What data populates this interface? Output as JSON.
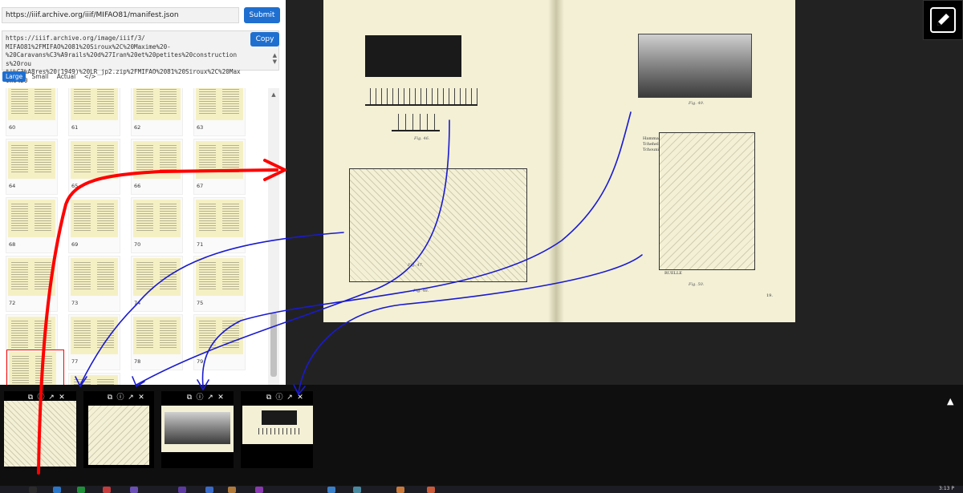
{
  "manifest_bar": {
    "url": "https://iiif.archive.org/iiif/MIFAO81/manifest.json",
    "submit_label": "Submit"
  },
  "iiif_image": {
    "url": "https://iiif.archive.org/image/iiif/3/\nMIFAO81%2FMIFAO%2081%20Siroux%2C%20Maxime%20-\n%20Caravans%C3%A9rails%20d%27Iran%20et%20petites%20constructions%20rou\nti%C3%A8res%20(1949)%20LR_jp2.zip%2FMIFAO%2081%20Siroux%2C%20Maxime%20",
    "copy_label": "Copy"
  },
  "size_options": [
    {
      "label": "Large",
      "active": true
    },
    {
      "label": "Small",
      "active": false
    },
    {
      "label": "Actual",
      "active": false
    },
    {
      "label": "</>",
      "active": false
    }
  ],
  "thumbnails": [
    "60",
    "61",
    "62",
    "63",
    "64",
    "65",
    "66",
    "67",
    "68",
    "69",
    "70",
    "71",
    "72",
    "73",
    "74",
    "75",
    "76",
    "77",
    "78",
    "79",
    "",
    ""
  ],
  "selected_thumbnail": "80",
  "scroll_arrows": {
    "up": "▲",
    "down": "▼"
  },
  "viewer": {
    "captions": {
      "fig_a": "Fig. 46.",
      "fig_b": "Fig. 47.",
      "fig_c": "Fig. 48.",
      "fig_d": "Fig. 49.",
      "fig_e": "Fig. 50."
    },
    "plan_labels": {
      "hammam": "Hammam",
      "tcheheh": "Tchehel-Soun",
      "tchouni": "Tchouni",
      "ruelle": "RUELLE",
      "page_num": "19."
    }
  },
  "edit_icon": "pencil-edit-icon",
  "panels": [
    {
      "name": "panel-1",
      "icons": [
        "copy-icon",
        "info-icon",
        "external-link-icon",
        "close-icon"
      ]
    },
    {
      "name": "panel-2",
      "icons": [
        "copy-icon",
        "info-icon",
        "external-link-icon",
        "close-icon"
      ]
    },
    {
      "name": "panel-3",
      "icons": [
        "copy-icon",
        "info-icon",
        "external-link-icon",
        "close-icon"
      ]
    },
    {
      "name": "panel-4",
      "icons": [
        "copy-icon",
        "info-icon",
        "external-link-icon",
        "close-icon"
      ]
    }
  ],
  "strip_toggle": "▲",
  "clock": "3:13 P",
  "colors": {
    "accent_blue": "#1f6fd0",
    "annotation_red": "#ff0000",
    "annotation_blue": "#1a1acf",
    "viewer_bg": "#222222",
    "page_bg": "#f3f0d6"
  }
}
